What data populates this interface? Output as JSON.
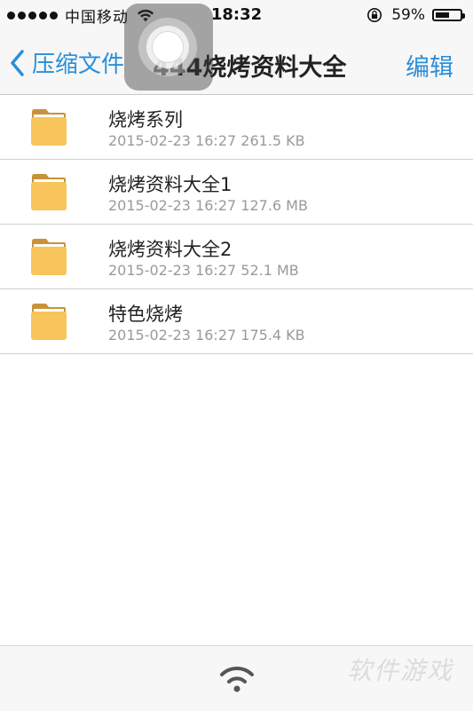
{
  "status_bar": {
    "carrier": "中国移动",
    "time": "18:32",
    "battery_percent": "59%",
    "battery_level": 0.59
  },
  "nav": {
    "back_label": "压缩文件",
    "title": "444烧烤资料大全",
    "edit_label": "编辑"
  },
  "files": [
    {
      "name": "烧烤系列",
      "date": "2015-02-23 16:27",
      "size": "261.5 KB",
      "icon": "folder-icon"
    },
    {
      "name": "烧烤资料大全1",
      "date": "2015-02-23 16:27",
      "size": "127.6 MB",
      "icon": "folder-icon"
    },
    {
      "name": "烧烤资料大全2",
      "date": "2015-02-23 16:27",
      "size": "52.1 MB",
      "icon": "folder-icon"
    },
    {
      "name": "特色烧烤",
      "date": "2015-02-23 16:27",
      "size": "175.4 KB",
      "icon": "folder-icon"
    }
  ],
  "toolbar": {
    "share_icon": "wifi-icon",
    "watermark": "软件游戏"
  },
  "colors": {
    "accent": "#2a8fd9",
    "folder": "#f7c55a",
    "folder_tab": "#c9923a"
  }
}
